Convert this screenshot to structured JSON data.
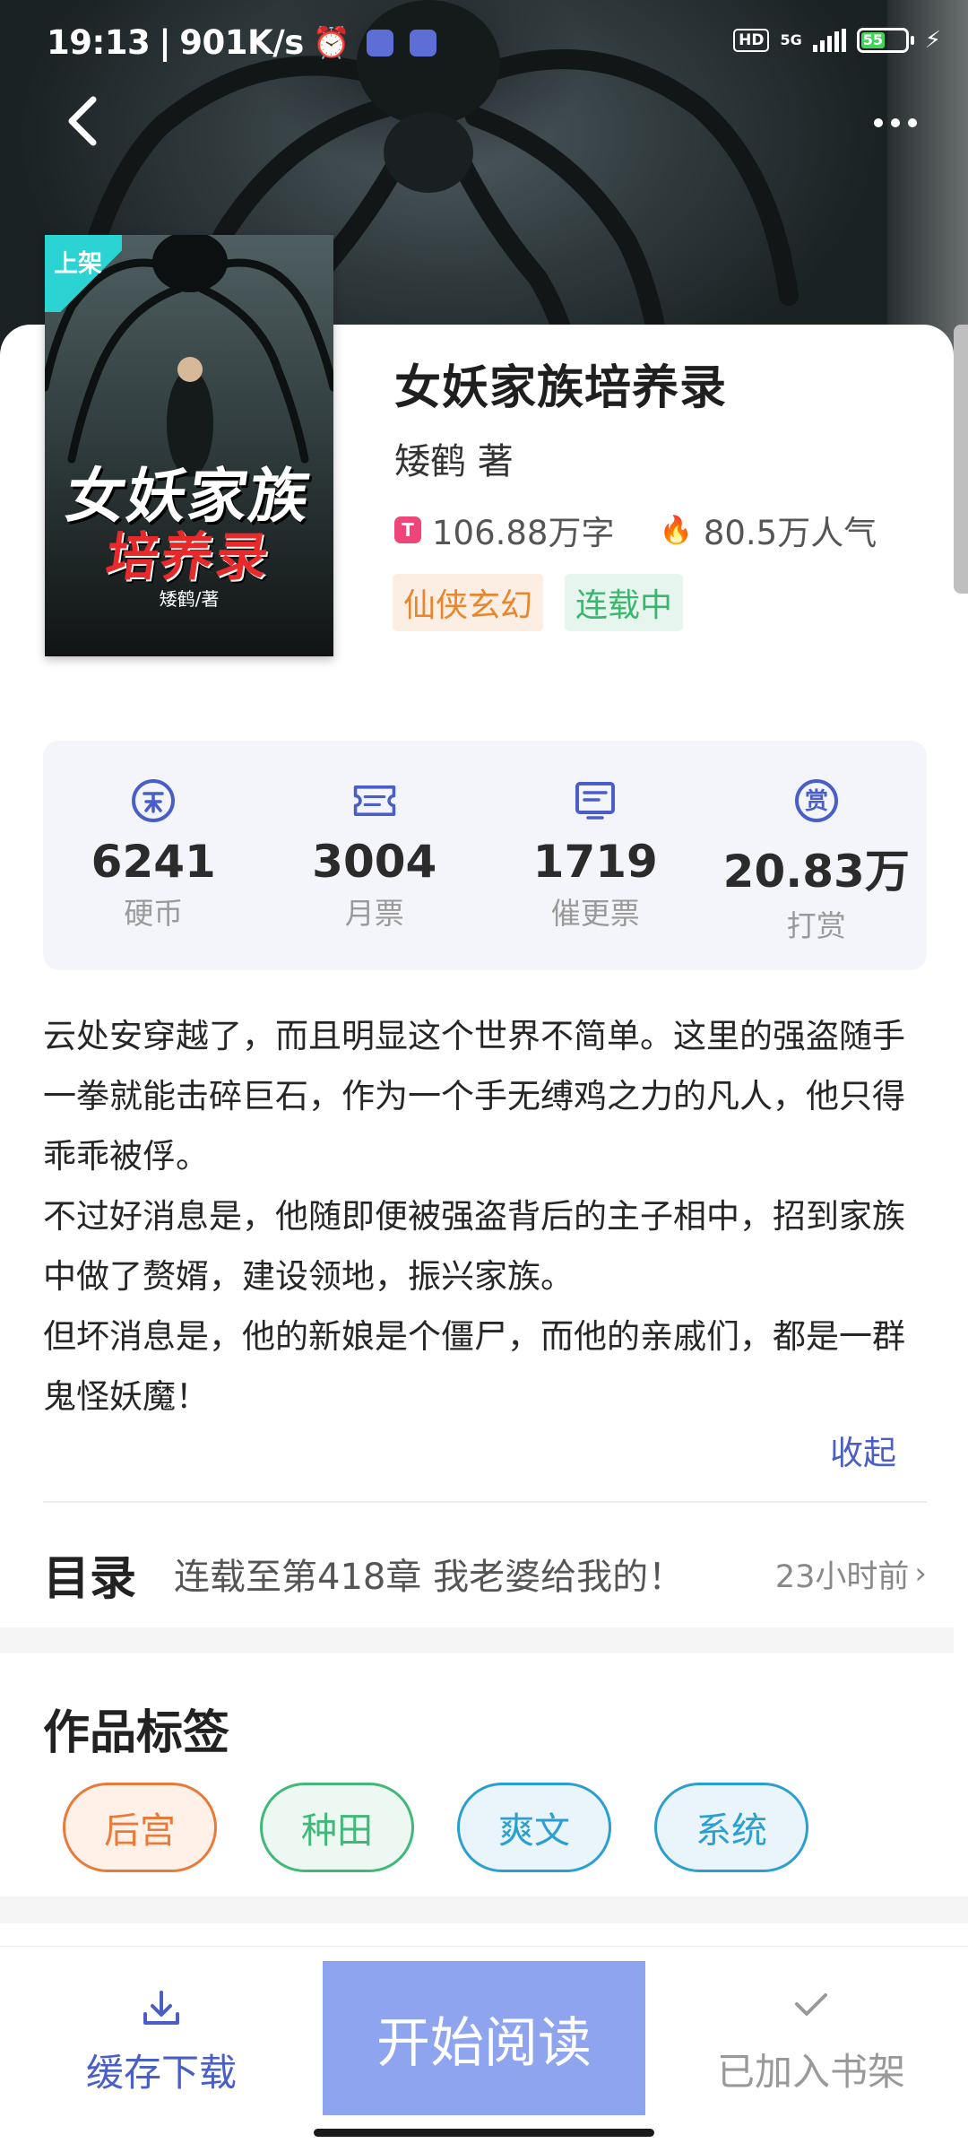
{
  "status_bar": {
    "time": "19:13",
    "speed": "901K/s",
    "hd": "HD",
    "network": "5G",
    "battery": "55"
  },
  "book": {
    "title": "女妖家族培养录",
    "author_line": "矮鹤 著",
    "word_count": "106.88万字",
    "popularity": "80.5万人气",
    "genre": "仙侠玄幻",
    "status": "连载中",
    "cover": {
      "badge": "上架",
      "title_line1": "女妖家族",
      "title_line2": "培养录",
      "author": "矮鹤/著"
    }
  },
  "stats": [
    {
      "icon": "coin-icon",
      "value": "6241",
      "label": "硬币"
    },
    {
      "icon": "ticket-icon",
      "value": "3004",
      "label": "月票"
    },
    {
      "icon": "update-ticket-icon",
      "value": "1719",
      "label": "催更票"
    },
    {
      "icon": "reward-icon",
      "value": "20.83万",
      "label": "打赏"
    }
  ],
  "synopsis": {
    "paragraphs": [
      "云处安穿越了，而且明显这个世界不简单。这里的强盗随手一拳就能击碎巨石，作为一个手无缚鸡之力的凡人，他只得乖乖被俘。",
      "不过好消息是，他随即便被强盗背后的主子相中，招到家族中做了赘婿，建设领地，振兴家族。",
      "但坏消息是，他的新娘是个僵尸，而他的亲戚们，都是一群鬼怪妖魔！"
    ],
    "collapse_label": "收起"
  },
  "catalog": {
    "label": "目录",
    "latest_chapter": "连载至第418章 我老婆给我的！",
    "updated": "23小时前"
  },
  "tags_section": {
    "heading": "作品标签",
    "tags": [
      "后宫",
      "种田",
      "爽文",
      "系统"
    ]
  },
  "bottom_bar": {
    "download_label": "缓存下载",
    "read_label": "开始阅读",
    "shelf_label": "已加入书架"
  },
  "colors": {
    "accent": "#4a5ec8",
    "read_button": "#8ea4ef",
    "genre": "#e8862f",
    "status": "#3ab66f"
  }
}
